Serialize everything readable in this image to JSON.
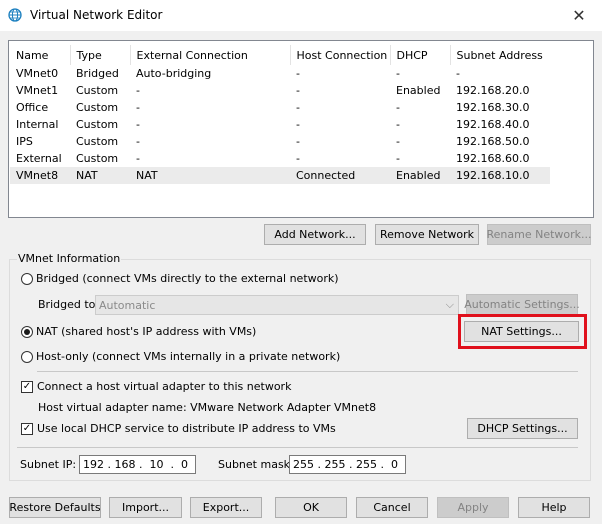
{
  "window": {
    "title": "Virtual Network Editor",
    "icon": "globe-icon",
    "close_glyph": "✕"
  },
  "netlist": {
    "columns": [
      "Name",
      "Type",
      "External Connection",
      "Host Connection",
      "DHCP",
      "Subnet Address"
    ],
    "rows": [
      [
        "VMnet0",
        "Bridged",
        "Auto-bridging",
        "-",
        "-",
        "-"
      ],
      [
        "VMnet1",
        "Custom",
        "-",
        "-",
        "Enabled",
        "192.168.20.0"
      ],
      [
        "Office",
        "Custom",
        "-",
        "-",
        "-",
        "192.168.30.0"
      ],
      [
        "Internal",
        "Custom",
        "-",
        "-",
        "-",
        "192.168.40.0"
      ],
      [
        "IPS",
        "Custom",
        "-",
        "-",
        "-",
        "192.168.50.0"
      ],
      [
        "External",
        "Custom",
        "-",
        "-",
        "-",
        "192.168.60.0"
      ],
      [
        "VMnet8",
        "NAT",
        "NAT",
        "Connected",
        "Enabled",
        "192.168.10.0"
      ]
    ],
    "selected_row": 6
  },
  "netbuttons": {
    "add": "Add Network...",
    "remove": "Remove Network",
    "rename": "Rename Network..."
  },
  "info": {
    "group_label": "VMnet Information",
    "bridged": "Bridged (connect VMs directly to the external network)",
    "bridged_to_label": "Bridged to:",
    "bridged_to_value": "Automatic",
    "auto_settings": "Automatic Settings...",
    "nat": "NAT (shared host's IP address with VMs)",
    "nat_settings": "NAT Settings...",
    "hostonly": "Host-only (connect VMs internally in a private network)",
    "selected_mode": "nat",
    "connect_adapter": "Connect a host virtual adapter to this network",
    "connect_adapter_checked": true,
    "adapter_name": "Host virtual adapter name: VMware Network Adapter VMnet8",
    "use_dhcp": "Use local DHCP service to distribute IP address to VMs",
    "use_dhcp_checked": true,
    "dhcp_settings": "DHCP Settings...",
    "subnet_ip_label": "Subnet IP:",
    "subnet_ip": "192 . 168 .  10  .  0",
    "subnet_mask_label": "Subnet mask:",
    "subnet_mask": "255 . 255 . 255 .  0"
  },
  "footer": {
    "restore": "Restore Defaults",
    "import": "Import...",
    "export": "Export...",
    "ok": "OK",
    "cancel": "Cancel",
    "apply": "Apply",
    "help": "Help"
  },
  "colors": {
    "highlight": "#e0101c",
    "selected_row": "#ebebeb"
  }
}
